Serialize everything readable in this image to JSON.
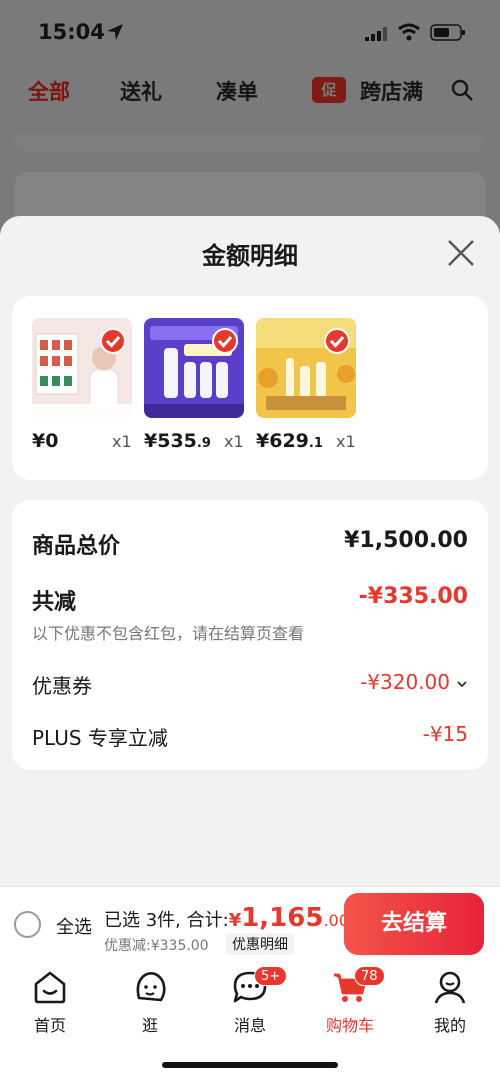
{
  "status": {
    "time": "15:04"
  },
  "top_tabs": {
    "items": [
      "全部",
      "送礼",
      "凑单"
    ],
    "promo_tag": "促",
    "promo_label": "跨店满"
  },
  "sheet": {
    "title": "金额明细",
    "products": [
      {
        "price_main": "¥0",
        "price_dec": "",
        "qty": "x1"
      },
      {
        "price_main": "¥535",
        "price_dec": ".9",
        "qty": "x1"
      },
      {
        "price_main": "¥629",
        "price_dec": ".1",
        "qty": "x1"
      }
    ],
    "summary": {
      "total_label": "商品总价",
      "total_value": "¥1,500.00",
      "reduce_label": "共减",
      "reduce_value": "-¥335.00",
      "reduce_note": "以下优惠不包含红包，请在结算页查看",
      "coupon_label": "优惠券",
      "coupon_value": "-¥320.00",
      "plus_label": "PLUS 专享立减",
      "plus_value": "-¥15"
    }
  },
  "checkout": {
    "select_all": "全选",
    "selected_text": "已选 3件, 合计:",
    "currency": "¥",
    "amount_int": "1,165",
    "amount_dec": ".00",
    "saved_text": "优惠减:¥335.00",
    "detail_label": "优惠明细",
    "button_label": "去结算"
  },
  "tabbar": {
    "items": [
      {
        "label": "首页"
      },
      {
        "label": "逛"
      },
      {
        "label": "消息",
        "badge": "5+"
      },
      {
        "label": "购物车",
        "badge": "78"
      },
      {
        "label": "我的"
      }
    ]
  },
  "colors": {
    "accent": "#e8372c",
    "dim_overlay": "#7a7a7a"
  }
}
